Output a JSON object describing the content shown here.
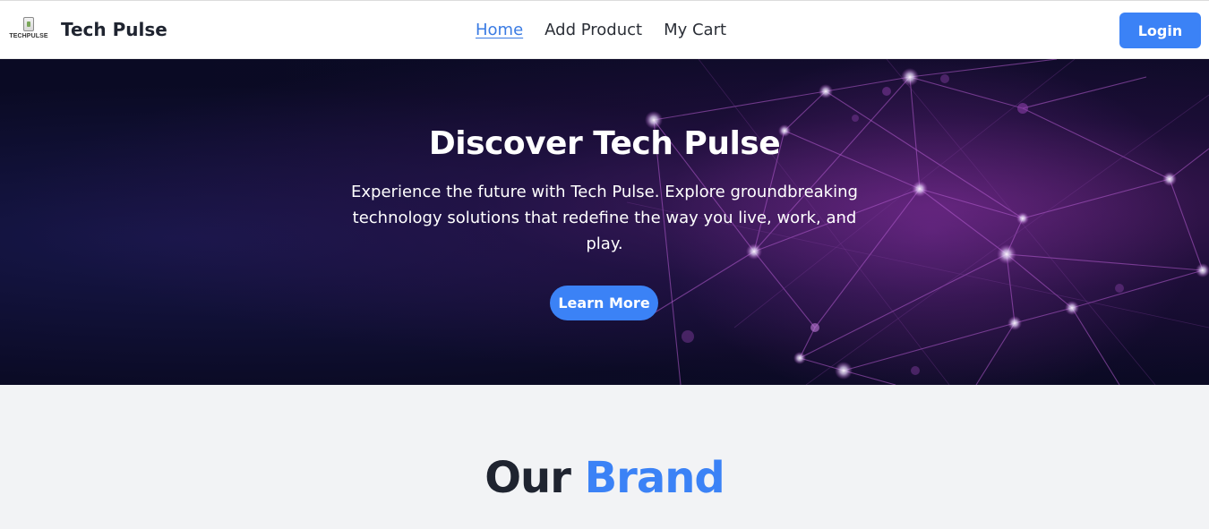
{
  "header": {
    "logo_text": "TECHPULSE",
    "brand_name": "Tech Pulse",
    "nav": {
      "home": "Home",
      "add_product": "Add Product",
      "my_cart": "My Cart"
    },
    "login_label": "Login"
  },
  "hero": {
    "title": "Discover Tech Pulse",
    "description": "Experience the future with Tech Pulse. Explore groundbreaking technology solutions that redefine the way you live, work, and play.",
    "button_label": "Learn More"
  },
  "brand_section": {
    "heading_part1": "Our",
    "heading_part2": "Brand"
  },
  "colors": {
    "accent": "#3b82f6",
    "text_dark": "#1f2430",
    "hero_bg": "#0c0c2a",
    "section_bg": "#f2f3f5"
  }
}
